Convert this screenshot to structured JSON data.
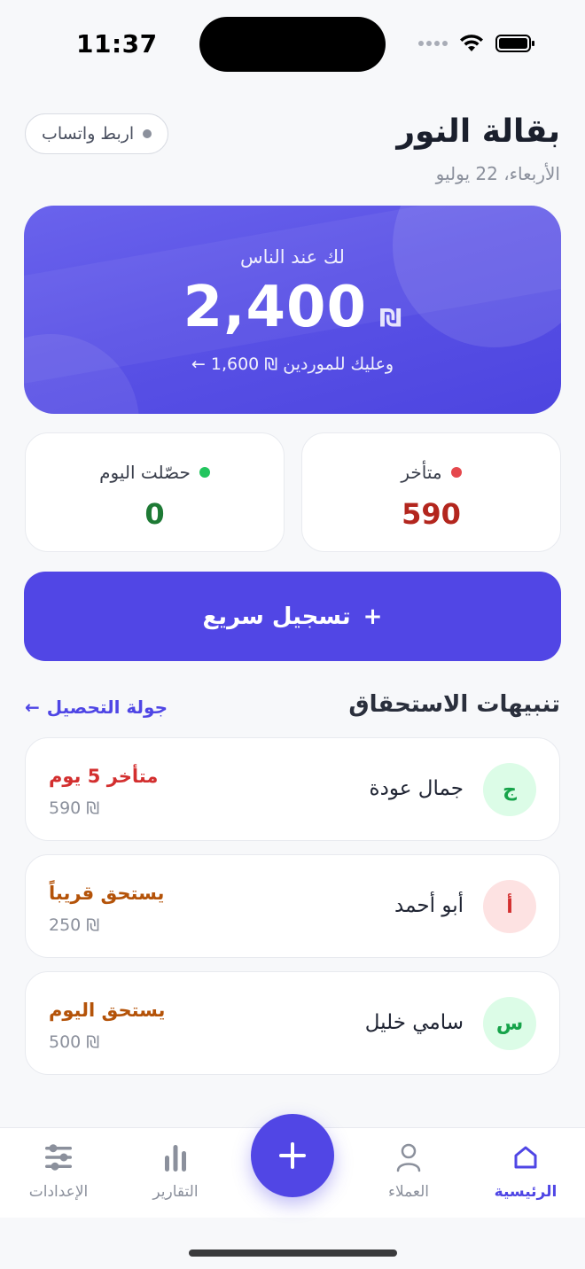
{
  "status_bar": {
    "time": "11:37"
  },
  "header": {
    "title": "بقالة النور",
    "date": "الأربعاء، 22 يوليو",
    "whatsapp_label": "اربط واتساب"
  },
  "hero": {
    "label": "لك عند الناس",
    "amount": "2,400",
    "currency": "₪",
    "suppliers_text": "وعليك للموردين ₪ 1,600 ←"
  },
  "stats": {
    "late": {
      "label": "متأخر",
      "value": "590",
      "color": "#b3261e",
      "dot_color": "#e5484d"
    },
    "today": {
      "label": "حصّلت اليوم",
      "value": "0",
      "color": "#1e7a35",
      "dot_color": "#22c55e"
    }
  },
  "quick_add": {
    "plus": "+",
    "label": "تسجيل سريع"
  },
  "alerts_section": {
    "title": "تنبيهات الاستحقاق",
    "link": "جولة التحصيل",
    "link_arrow": "←",
    "items": [
      {
        "initial": "ج",
        "name": "جمال عودة",
        "status": "متأخر 5 يوم",
        "amount": "590 ₪",
        "status_color": "#d32f2f",
        "avatar_bg": "#dcfce7",
        "avatar_color": "#16a34a"
      },
      {
        "initial": "أ",
        "name": "أبو أحمد",
        "status": "يستحق قريباً",
        "amount": "250 ₪",
        "status_color": "#b45309",
        "avatar_bg": "#fde2e2",
        "avatar_color": "#d32f2f"
      },
      {
        "initial": "س",
        "name": "سامي خليل",
        "status": "يستحق اليوم",
        "amount": "500 ₪",
        "status_color": "#b45309",
        "avatar_bg": "#dcfce7",
        "avatar_color": "#16a34a"
      }
    ]
  },
  "nav": {
    "home": "الرئيسية",
    "customers": "العملاء",
    "reports": "التقارير",
    "settings": "الإعدادات"
  },
  "icons": {
    "whatsapp_dot": "dot-icon",
    "home": "home-icon",
    "customers": "person-icon",
    "add": "plus-icon",
    "reports": "bar-chart-icon",
    "settings": "sliders-icon"
  },
  "colors": {
    "accent": "#5146e5",
    "background": "#f7f8fa"
  }
}
